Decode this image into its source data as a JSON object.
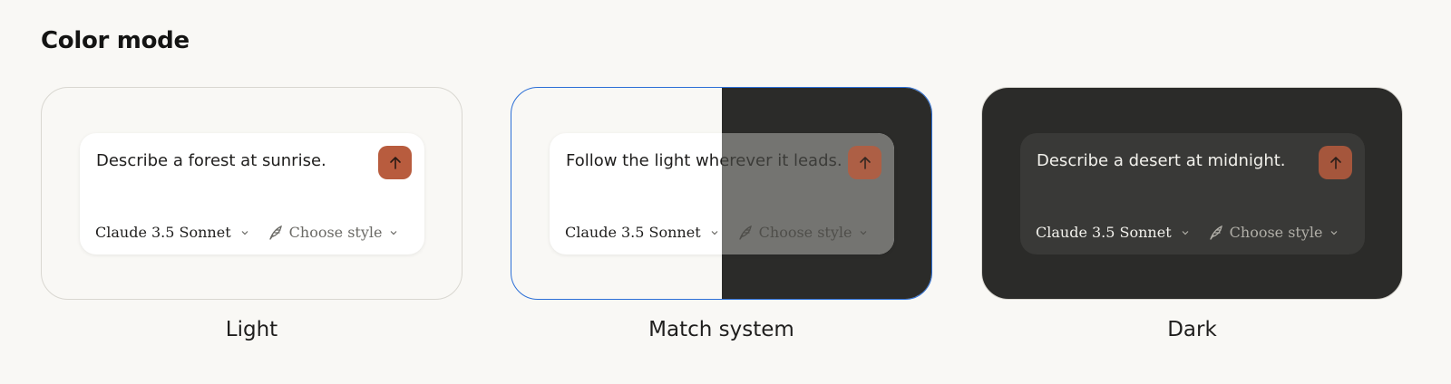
{
  "section": {
    "title": "Color mode"
  },
  "common": {
    "model_label": "Claude 3.5 Sonnet",
    "style_label": "Choose style"
  },
  "options": {
    "light": {
      "label": "Light",
      "prompt": "Describe a forest at sunrise.",
      "selected": false
    },
    "system": {
      "label": "Match system",
      "prompt": "Follow the light wherever it leads.",
      "selected": true
    },
    "dark": {
      "label": "Dark",
      "prompt": "Describe a desert at midnight.",
      "selected": false
    }
  },
  "colors": {
    "accent": "#2c6fd6",
    "send_button": "#b85c3e",
    "light_bg": "#f9f8f5",
    "dark_bg": "#2b2b29"
  },
  "icons": {
    "send": "arrow-up-icon",
    "dropdown": "chevron-down-icon",
    "style": "feather-pen-icon"
  }
}
